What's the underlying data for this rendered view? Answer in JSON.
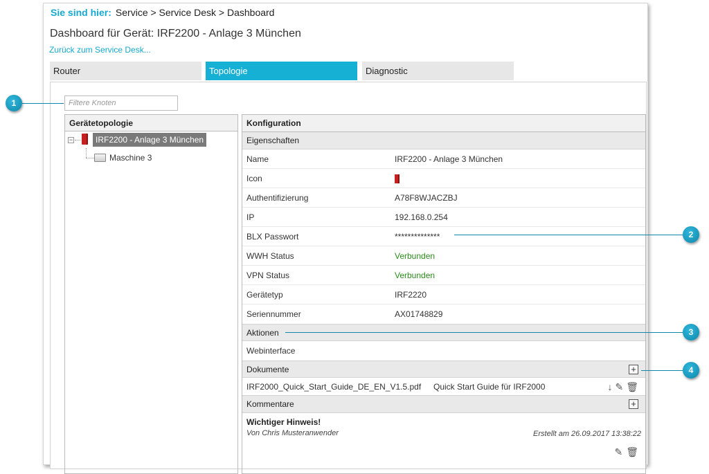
{
  "breadcrumb": {
    "lead": "Sie sind hier:",
    "path": "Service > Service Desk > Dashboard"
  },
  "page_title": "Dashboard für Gerät: IRF2200 - Anlage 3 München",
  "back_link": "Zurück zum Service Desk...",
  "tabs": [
    {
      "label": "Router",
      "active": false
    },
    {
      "label": "Topologie",
      "active": true
    },
    {
      "label": "Diagnostic",
      "active": false
    }
  ],
  "filter": {
    "placeholder": "Filtere Knoten",
    "value": ""
  },
  "tree": {
    "heading": "Gerätetopologie",
    "toggle": "−",
    "root": "IRF2200 - Anlage 3 München",
    "child": "Maschine 3"
  },
  "config": {
    "heading": "Konfiguration",
    "properties_heading": "Eigenschaften",
    "rows": [
      {
        "key": "Name",
        "value": "IRF2200 - Anlage 3 München",
        "status": false
      },
      {
        "key": "Icon",
        "value": "",
        "status": false,
        "icon": "router-icon"
      },
      {
        "key": "Authentifizierung",
        "value": "A78F8WJACZBJ",
        "status": false
      },
      {
        "key": "IP",
        "value": "192.168.0.254",
        "status": false
      },
      {
        "key": "BLX Passwort",
        "value": "**************",
        "status": false
      },
      {
        "key": "WWH Status",
        "value": "Verbunden",
        "status": true
      },
      {
        "key": "VPN Status",
        "value": "Verbunden",
        "status": true
      },
      {
        "key": "Gerätetyp",
        "value": "IRF2220",
        "status": false
      },
      {
        "key": "Seriennummer",
        "value": "AX01748829",
        "status": false
      }
    ],
    "actions_heading": "Aktionen",
    "webinterface_link": "Webinterface",
    "documents_heading": "Dokumente",
    "document": {
      "filename": "IRF2000_Quick_Start_Guide_DE_EN_V1.5.pdf",
      "description": "Quick Start Guide für IRF2000"
    },
    "comments_heading": "Kommentare",
    "comment": {
      "title": "Wichtiger Hinweis!",
      "author": "Von Chris Musteranwender",
      "date": "Erstellt am 26.09.2017 13:38:22"
    }
  },
  "callouts": [
    "1",
    "2",
    "3",
    "4"
  ],
  "colors": {
    "accent": "#16b0d5",
    "status_ok": "#2a8a1a",
    "router_red": "#c62020"
  }
}
